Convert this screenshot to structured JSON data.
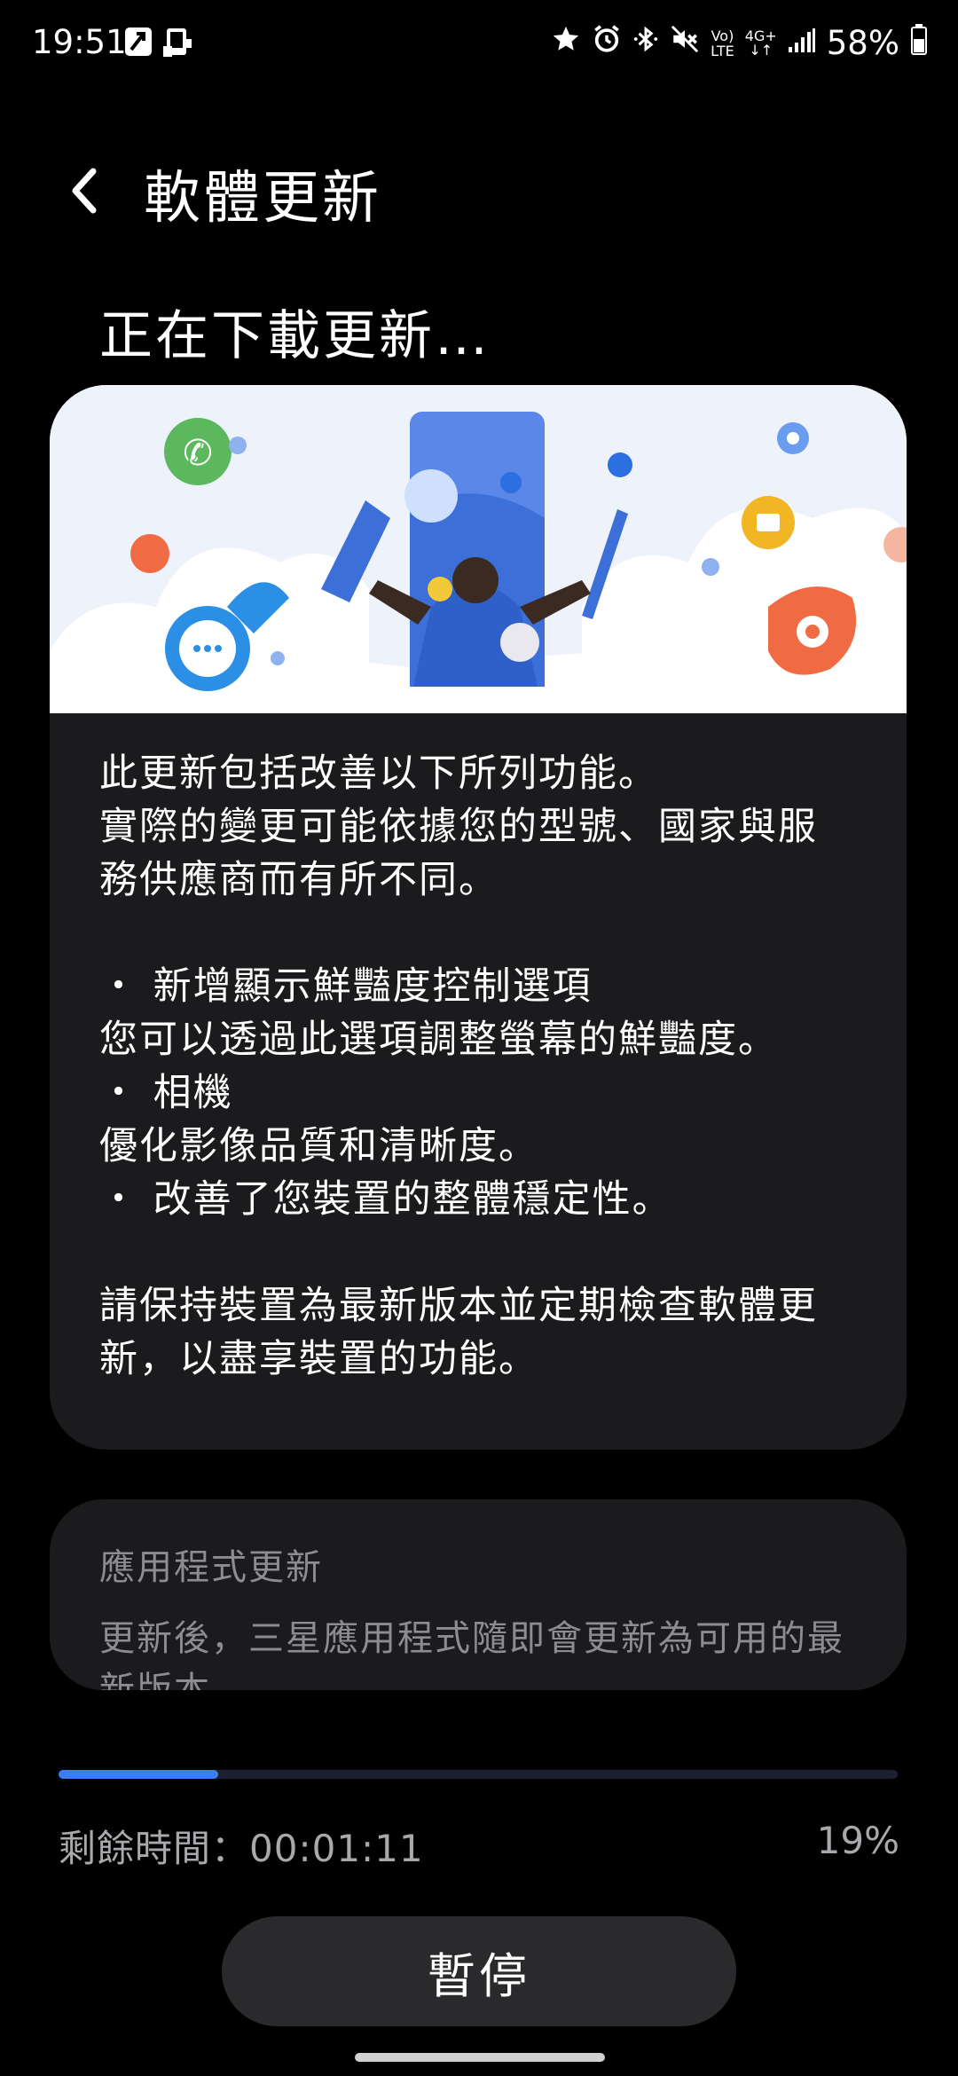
{
  "status_bar": {
    "time": "19:51",
    "battery_percent": "58%",
    "network_label_top": "Vo)",
    "network_label_bottom": "LTE",
    "network_type": "4G+",
    "left_icons": [
      "upload-icon",
      "screenshot-icon"
    ],
    "right_icons": [
      "star-icon",
      "alarm-icon",
      "bluetooth-icon",
      "mute-icon",
      "volte-icon",
      "data-arrows-icon",
      "signal-icon",
      "battery-icon"
    ]
  },
  "header": {
    "title": "軟體更新",
    "back_icon": "chevron-left-icon"
  },
  "download": {
    "heading": "正在下載更新…"
  },
  "release_notes": {
    "intro": [
      "此更新包括改善以下所列功能。",
      "實際的變更可能依據您的型號、國家與服",
      "務供應商而有所不同。"
    ],
    "items": [
      "・ 新增顯示鮮豔度控制選項",
      "您可以透過此選項調整螢幕的鮮豔度。",
      "・ 相機",
      "優化影像品質和清晰度。",
      "・ 改善了您裝置的整體穩定性。"
    ],
    "outro": [
      "請保持裝置為最新版本並定期檢查軟體更",
      "新，以盡享裝置的功能。"
    ]
  },
  "app_update": {
    "title": "應用程式更新",
    "description": "更新後，三星應用程式隨即會更新為可用的最新版本。"
  },
  "progress": {
    "fraction": 0.19,
    "remaining_time": "剩餘時間：00:01:11",
    "percent_label": "19%"
  },
  "actions": {
    "pause_label": "暫停"
  },
  "colors": {
    "background": "#000000",
    "card": "#1b1b1e",
    "accent": "#3a7ef5",
    "muted_text": "#8c8c92",
    "button": "#2a2a2c"
  }
}
